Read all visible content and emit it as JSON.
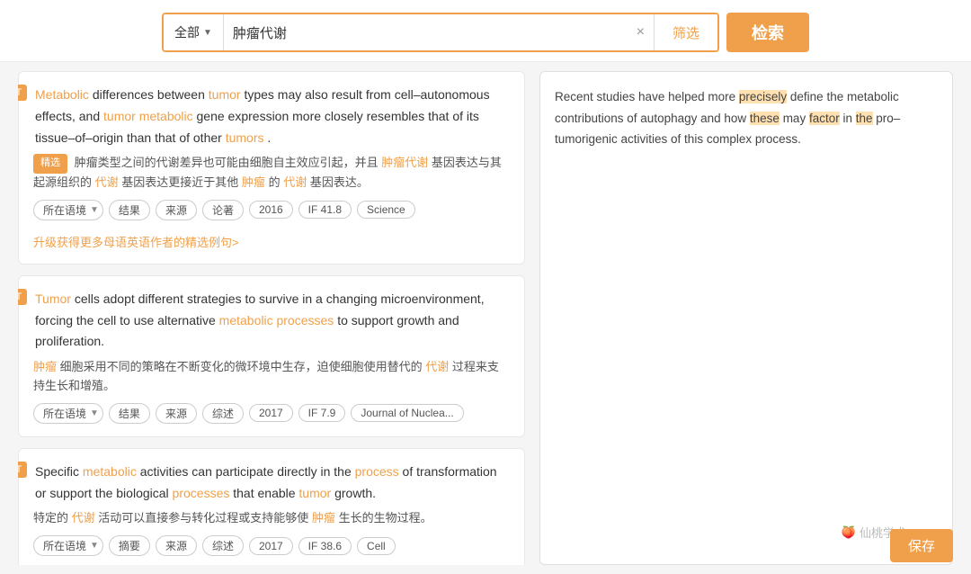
{
  "search": {
    "type_label": "全部",
    "query": "肿瘤代谢",
    "clear_icon": "×",
    "filter_label": "筛选",
    "search_label": "检索"
  },
  "results": [
    {
      "id": 1,
      "en_parts": [
        {
          "text": "Metabolic",
          "type": "orange"
        },
        {
          "text": " differences between ",
          "type": "normal"
        },
        {
          "text": "tumor",
          "type": "orange"
        },
        {
          "text": " types may also result from cell–autonomous effects, and ",
          "type": "normal"
        },
        {
          "text": "tumor",
          "type": "orange"
        },
        {
          "text": " ",
          "type": "normal"
        },
        {
          "text": "metabolic",
          "type": "orange"
        },
        {
          "text": " gene expression more closely resembles that of its tissue–of–origin than that of other ",
          "type": "normal"
        },
        {
          "text": "tumors",
          "type": "orange"
        },
        {
          "text": ".",
          "type": "normal"
        }
      ],
      "zh_parts": [
        {
          "text": "精选",
          "type": "badge"
        },
        {
          "text": " 肿瘤类型之间的代谢差异也可能由细胞自主效应引起，并且",
          "type": "normal"
        },
        {
          "text": "肿瘤代谢",
          "type": "orange"
        },
        {
          "text": "基因表达与其起源组织的",
          "type": "normal"
        },
        {
          "text": "代谢",
          "type": "orange"
        },
        {
          "text": "基因表达更接近于其他",
          "type": "normal"
        },
        {
          "text": "肿瘤",
          "type": "orange"
        },
        {
          "text": "的",
          "type": "normal"
        },
        {
          "text": "代谢",
          "type": "orange"
        },
        {
          "text": "基因表达。",
          "type": "normal"
        }
      ],
      "tags": [
        "所在语境",
        "结果",
        "来源",
        "论著",
        "2016",
        "IF 41.8",
        "Science"
      ],
      "upgrade_text": "升级获得更多母语英语作者的精选例句>"
    },
    {
      "id": 2,
      "en_parts": [
        {
          "text": "Tumor",
          "type": "orange"
        },
        {
          "text": " cells adopt different strategies to survive in a changing microenvironment, forcing the cell to use alternative ",
          "type": "normal"
        },
        {
          "text": "metabolic processes",
          "type": "orange"
        },
        {
          "text": " to support growth and proliferation.",
          "type": "normal"
        }
      ],
      "zh_parts": [
        {
          "text": "肿瘤",
          "type": "orange"
        },
        {
          "text": "细胞采用不同的策略在不断变化的微环境中生存，迫使细胞使用替代的",
          "type": "normal"
        },
        {
          "text": "代谢",
          "type": "orange"
        },
        {
          "text": "过程来支持生长和增殖。",
          "type": "normal"
        }
      ],
      "tags": [
        "所在语境",
        "结果",
        "来源",
        "综述",
        "2017",
        "IF 7.9",
        "Journal of Nuclea..."
      ],
      "upgrade_text": null
    },
    {
      "id": 3,
      "en_parts": [
        {
          "text": "Specific ",
          "type": "normal"
        },
        {
          "text": "metabolic",
          "type": "orange"
        },
        {
          "text": " activities can participate directly in the ",
          "type": "normal"
        },
        {
          "text": "process",
          "type": "orange"
        },
        {
          "text": " of transformation or support the biological ",
          "type": "normal"
        },
        {
          "text": "processes",
          "type": "orange"
        },
        {
          "text": " that enable ",
          "type": "normal"
        },
        {
          "text": "tumor",
          "type": "orange"
        },
        {
          "text": " growth.",
          "type": "normal"
        }
      ],
      "zh_parts": [
        {
          "text": "特定的",
          "type": "normal"
        },
        {
          "text": "代谢",
          "type": "orange"
        },
        {
          "text": "活动可以直接参与转化过程或支持能够使",
          "type": "normal"
        },
        {
          "text": "肿瘤",
          "type": "orange"
        },
        {
          "text": "生长的生物过程。",
          "type": "normal"
        }
      ],
      "tags": [
        "所在语境",
        "摘要",
        "来源",
        "综述",
        "2017",
        "IF 38.6",
        "Cell"
      ],
      "upgrade_text": null
    }
  ],
  "right_panel": {
    "text": "Recent studies have helped more precisely define the metabolic contributions of autophagy and how these may factor in the pro–tumorigenic activities of this complex process."
  },
  "watermark": {
    "icon": "🍑",
    "text": "仙桃学术"
  },
  "save_label": "保存"
}
